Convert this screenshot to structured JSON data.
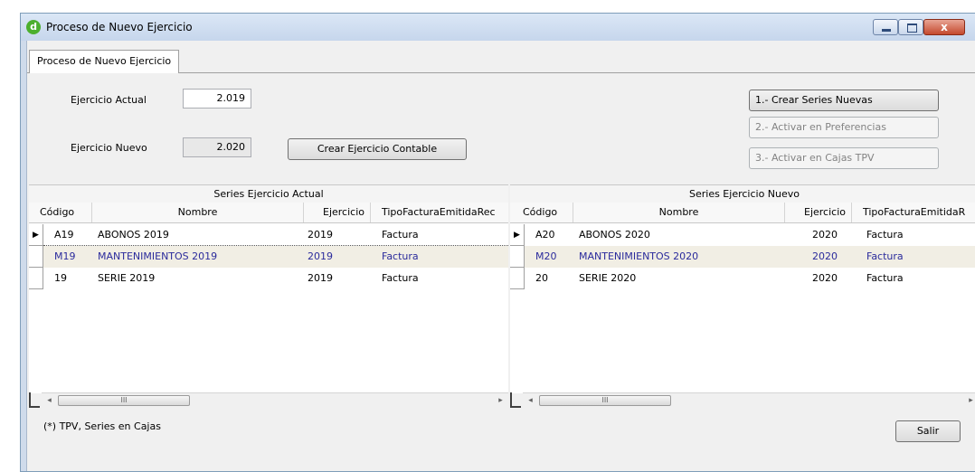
{
  "window": {
    "title": "Proceso de Nuevo Ejercicio",
    "app_icon_letter": "d",
    "close_glyph": "x"
  },
  "tab": {
    "label": "Proceso de Nuevo Ejercicio"
  },
  "form": {
    "actual_label": "Ejercicio Actual",
    "actual_value": "2.019",
    "nuevo_label": "Ejercicio Nuevo",
    "nuevo_value": "2.020",
    "crear_ejercicio_button": "Crear Ejercicio Contable",
    "step1_button": "1.- Crear Series Nuevas",
    "step2_button": "2.- Activar en Preferencias",
    "step3_button": "3.- Activar en Cajas TPV"
  },
  "grid_actual": {
    "caption": "Series Ejercicio Actual",
    "columns": [
      "Código",
      "Nombre",
      "Ejercicio",
      "TipoFacturaEmitidaRec"
    ],
    "rows": [
      [
        "A19",
        "ABONOS 2019",
        "2019",
        "Factura"
      ],
      [
        "M19",
        "MANTENIMIENTOS 2019",
        "2019",
        "Factura"
      ],
      [
        "19",
        "SERIE 2019",
        "2019",
        "Factura"
      ]
    ]
  },
  "grid_nuevo": {
    "caption": "Series Ejercicio Nuevo",
    "columns": [
      "Código",
      "Nombre",
      "Ejercicio",
      "TipoFacturaEmitidaR"
    ],
    "rows": [
      [
        "A20",
        "ABONOS 2020",
        "2020",
        "Factura"
      ],
      [
        "M20",
        "MANTENIMIENTOS 2020",
        "2020",
        "Factura"
      ],
      [
        "20",
        "SERIE 2020",
        "2020",
        "Factura"
      ]
    ]
  },
  "scroll": {
    "left_arrow": "◂",
    "right_arrow": "▸",
    "thumb_grip": "III",
    "row_pointer": "▶"
  },
  "footer": {
    "note": "(*) TPV, Series en Cajas",
    "salir_button": "Salir"
  },
  "colors": {
    "selected_row_bg": "#f1eee4",
    "selected_row_text": "#2b2b9c",
    "title_bg": "#cfdbeb",
    "close_button": "#c4492d"
  }
}
